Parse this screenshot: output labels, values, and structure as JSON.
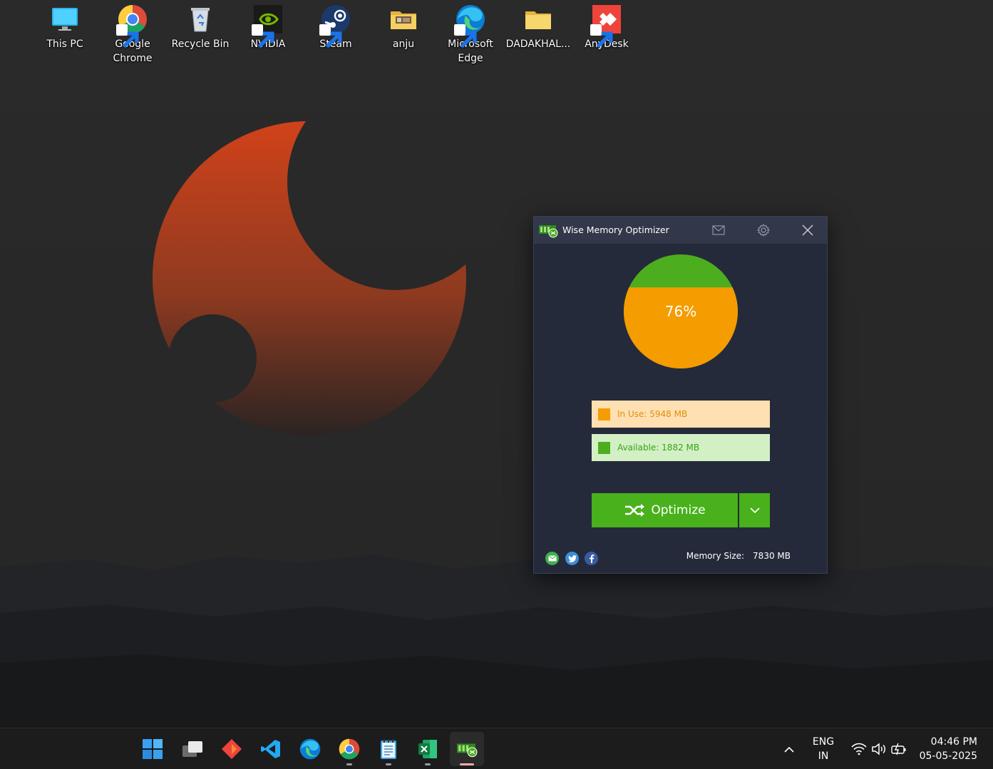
{
  "desktop": {
    "icons": [
      {
        "label": "This PC",
        "icon": "monitor-icon"
      },
      {
        "label": "Google Chrome",
        "icon": "chrome-icon"
      },
      {
        "label": "Recycle Bin",
        "icon": "recycle-bin-icon"
      },
      {
        "label": "NVIDIA",
        "icon": "nvidia-icon"
      },
      {
        "label": "Steam",
        "icon": "steam-icon"
      },
      {
        "label": "anju",
        "icon": "folder-icon"
      },
      {
        "label": "Microsoft Edge",
        "icon": "edge-icon"
      },
      {
        "label": "DADAKHAL...",
        "icon": "folder-icon"
      },
      {
        "label": "AnyDesk",
        "icon": "anydesk-icon"
      }
    ]
  },
  "window": {
    "title": "Wise Memory Optimizer",
    "usage_percent": 76,
    "usage_label": "76%",
    "in_use": {
      "label": "In Use: 5948 MB",
      "value_mb": 5948,
      "color": "#f59c00"
    },
    "available": {
      "label": "Available: 1882 MB",
      "value_mb": 1882,
      "color": "#4cae1e"
    },
    "optimize_label": "Optimize",
    "memory_size_label": "Memory Size:",
    "memory_size_value": "7830 MB"
  },
  "taskbar": {
    "apps": [
      "windows-start-icon",
      "task-view-icon",
      "anydesk-icon",
      "vscode-icon",
      "edge-icon",
      "chrome-icon",
      "notepad-icon",
      "excel-icon",
      "wise-memory-optimizer-icon"
    ],
    "language_line1": "ENG",
    "language_line2": "IN",
    "time": "04:46 PM",
    "date": "05-05-2025"
  }
}
